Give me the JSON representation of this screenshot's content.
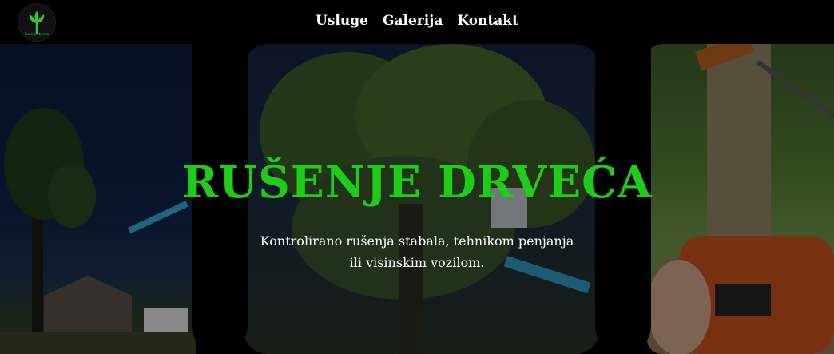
{
  "header": {
    "logo_caption": "Rusenje drveca",
    "nav": [
      {
        "label": "Usluge"
      },
      {
        "label": "Galerija"
      },
      {
        "label": "Kontakt"
      }
    ]
  },
  "hero": {
    "title": "RUŠENJE DRVEĆA",
    "subtitle_line1": "Kontrolirano rušenja stabala, tehnikom penjanja",
    "subtitle_line2": "ili visinskim vozilom."
  },
  "colors": {
    "accent": "#1fcc1a",
    "background": "#000000",
    "text": "#ffffff"
  }
}
